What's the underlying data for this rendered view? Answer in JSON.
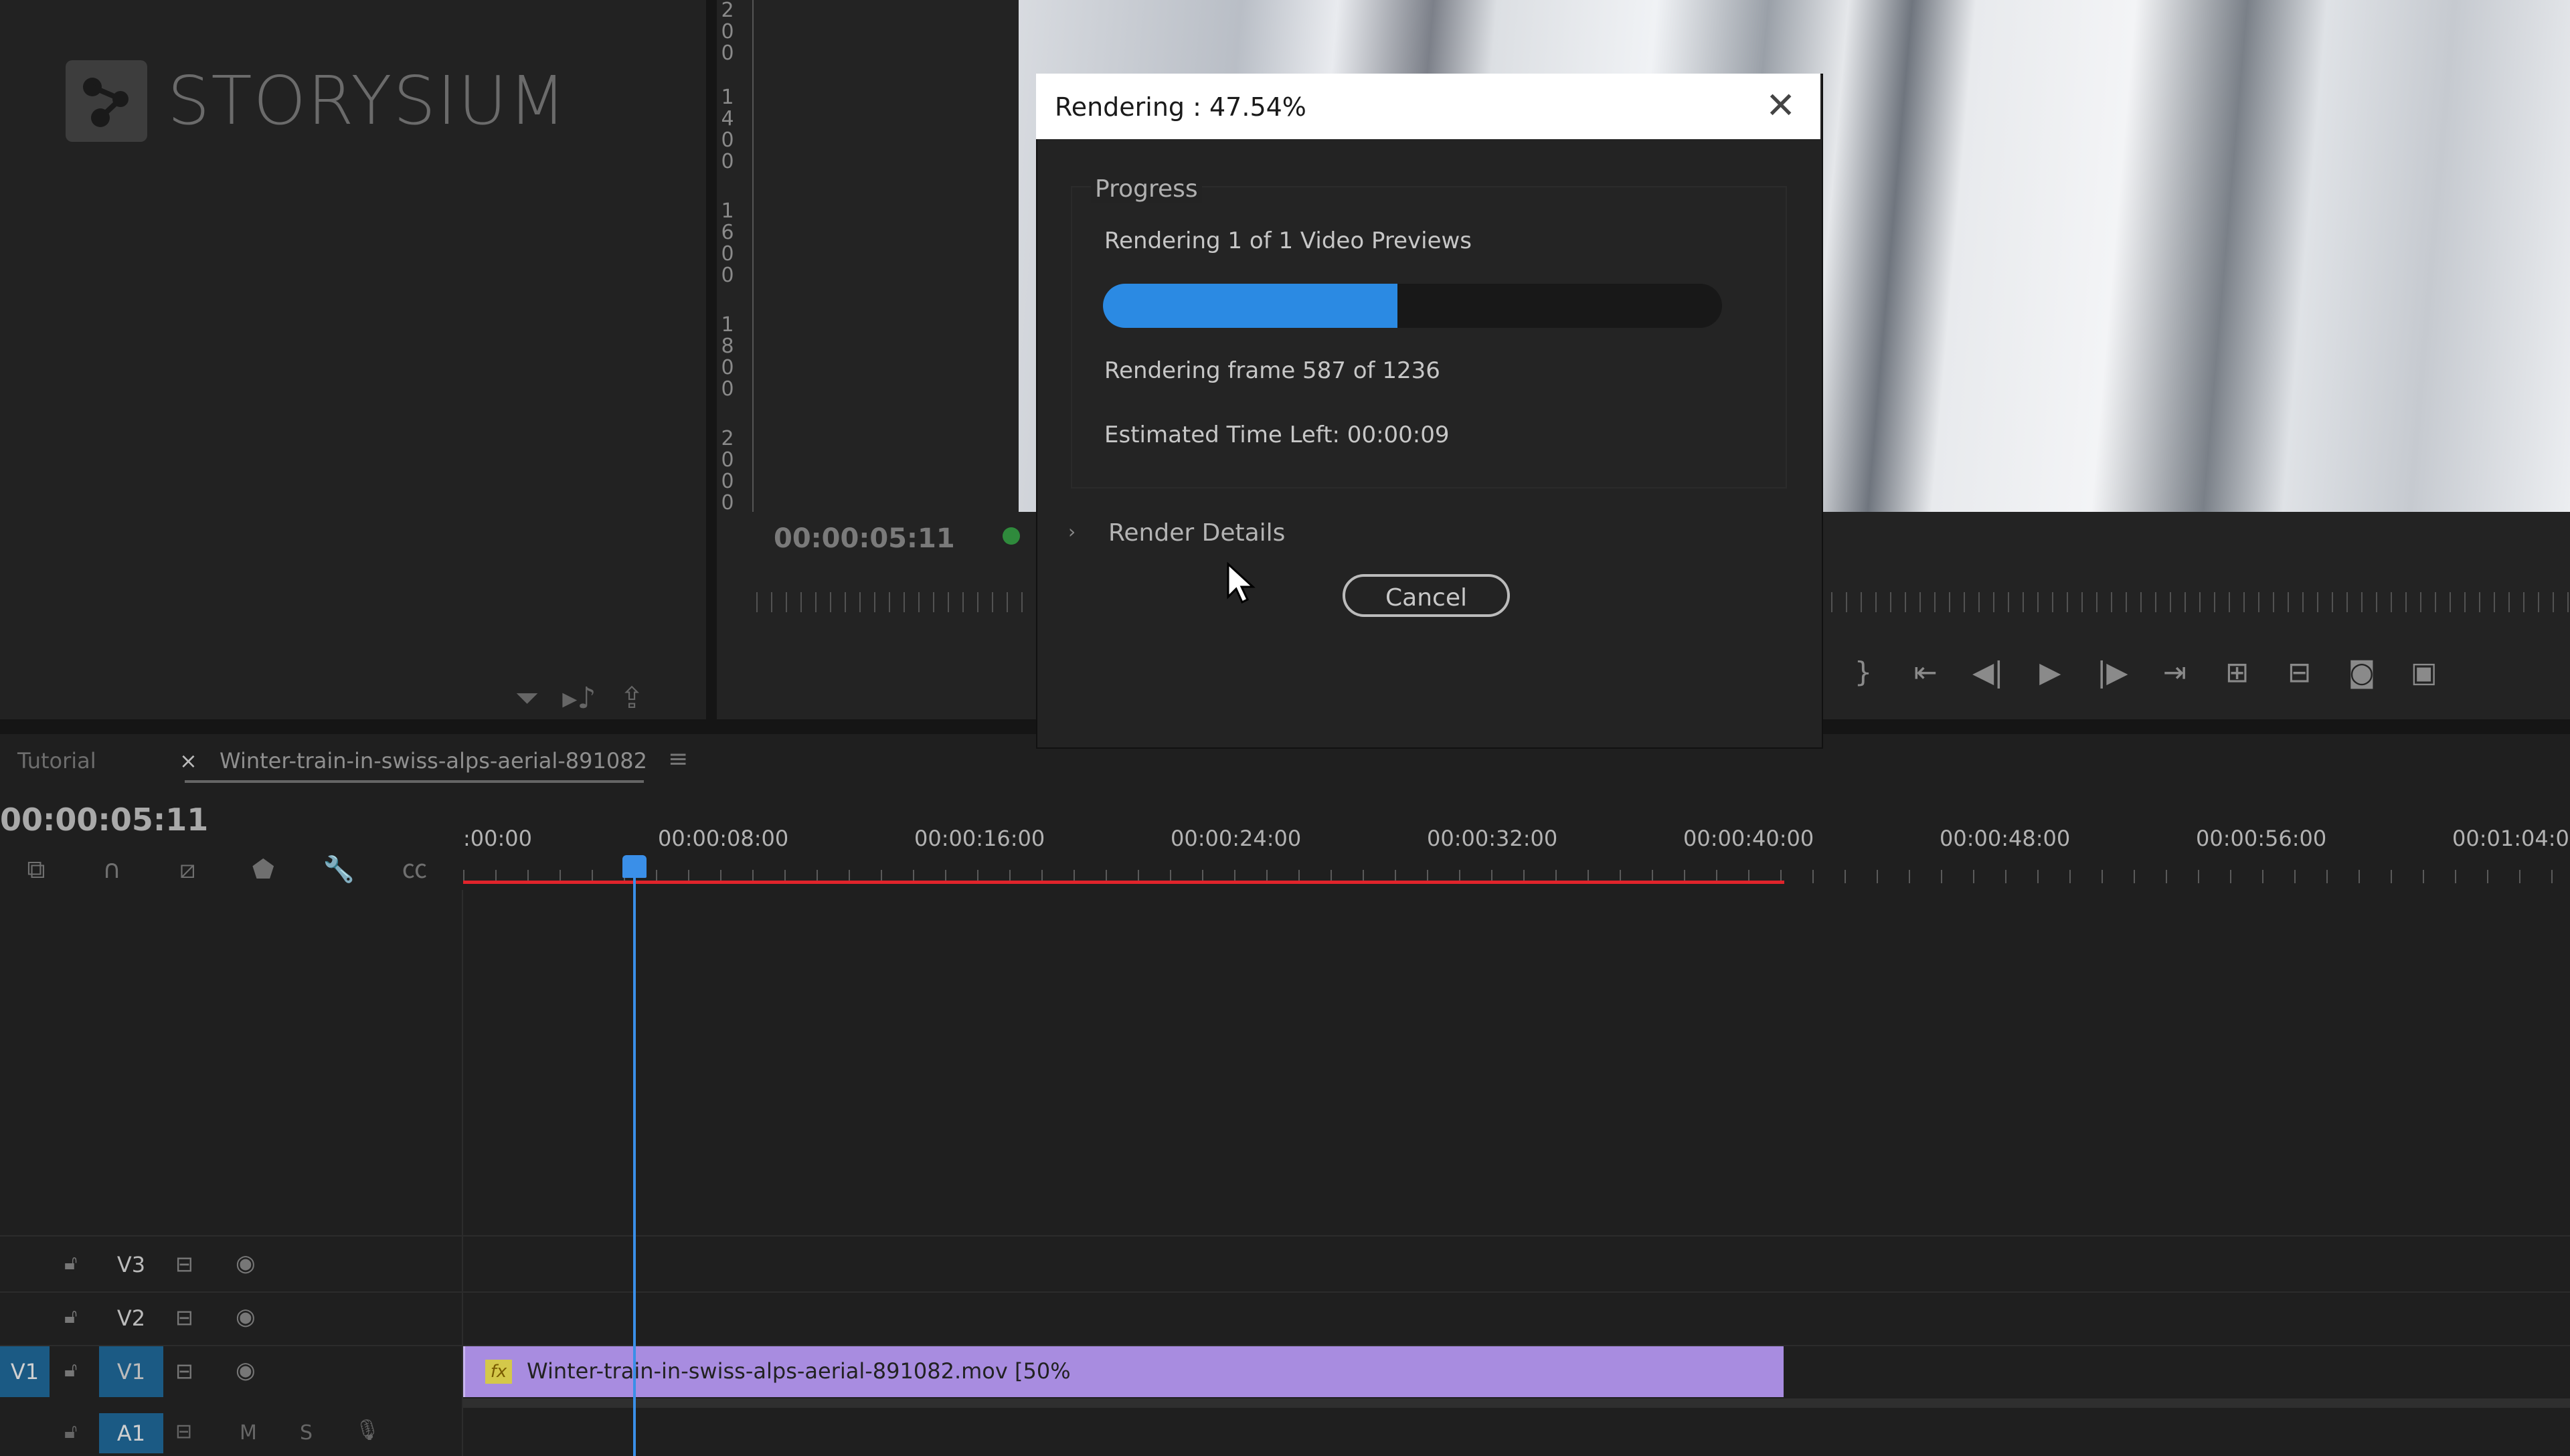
{
  "project_panel": {
    "logo_text": "STORYSIUM",
    "tools": [
      "filter-icon",
      "automate-icon",
      "export-icon"
    ]
  },
  "source_monitor": {
    "ruler_digits": [
      "2",
      "0",
      "0",
      "1",
      "4",
      "0",
      "0",
      "1",
      "6",
      "0",
      "0",
      "1",
      "8",
      "0",
      "0",
      "2",
      "0",
      "0",
      "0"
    ],
    "timecode": "00:00:05:11",
    "transport_icons": [
      "mark-out-icon",
      "go-to-in-icon",
      "step-back-icon",
      "play-icon",
      "step-forward-icon",
      "go-to-out-icon",
      "insert-icon",
      "overwrite-icon",
      "camera-icon",
      "export-frame-icon"
    ]
  },
  "timeline": {
    "tabs": {
      "tutorial": "Tutorial",
      "close": "×",
      "sequence": "Winter-train-in-swiss-alps-aerial-891082",
      "menu": "≡"
    },
    "timecode": "00:00:05:11",
    "ruler_labels": [
      ":00:00",
      "00:00:08:00",
      "00:00:16:00",
      "00:00:24:00",
      "00:00:32:00",
      "00:00:40:00",
      "00:00:48:00",
      "00:00:56:00",
      "00:01:04:00"
    ],
    "tracks": {
      "v3": "V3",
      "v2": "V2",
      "v1_source": "V1",
      "v1": "V1",
      "a1": "A1",
      "a1_m": "M",
      "a1_s": "S"
    },
    "clip": {
      "fx": "fx",
      "label": "Winter-train-in-swiss-alps-aerial-891082.mov [50%"
    }
  },
  "dialog": {
    "title": "Rendering : 47.54%",
    "close": "✕",
    "group_title": "Progress",
    "line_previews": "Rendering 1 of 1 Video Previews",
    "progress_fraction": 0.4754,
    "line_frame": "Rendering frame 587 of 1236",
    "line_time_left": "Estimated Time Left: 00:00:09",
    "details_arrow": "›",
    "details_label": "Render Details",
    "cancel_label": "Cancel"
  },
  "colors": {
    "accent": "#2b8ae3",
    "render_bar": "#e0242b",
    "clip": "#a88ce0",
    "track_target": "#1b5a84"
  }
}
